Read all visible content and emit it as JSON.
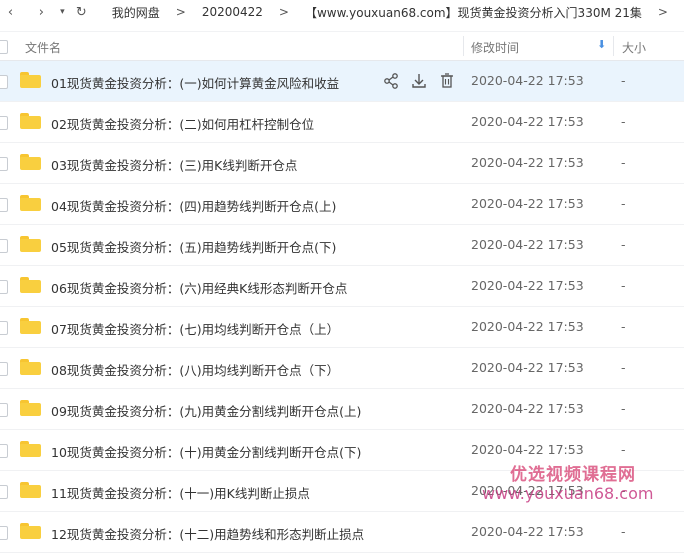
{
  "nav": {
    "back_icon": "chevron-left-icon",
    "forward_icon": "chevron-right-icon",
    "dropdown_icon": "caret-down-icon",
    "refresh_icon": "refresh-icon",
    "breadcrumbs": [
      "我的网盘",
      "20200422",
      "【www.youxuan68.com】现货黄金投资分析入门330M 21集"
    ],
    "separator": ">"
  },
  "columns": {
    "name": "文件名",
    "modified": "修改时间",
    "size": "大小",
    "sort_icon": "arrow-down-icon"
  },
  "files": [
    {
      "name": "01现货黄金投资分析：(一)如何计算黄金风险和收益",
      "modified": "2020-04-22 17:53",
      "size": "-"
    },
    {
      "name": "02现货黄金投资分析：(二)如何用杠杆控制仓位",
      "modified": "2020-04-22 17:53",
      "size": "-"
    },
    {
      "name": "03现货黄金投资分析：(三)用K线判断开仓点",
      "modified": "2020-04-22 17:53",
      "size": "-"
    },
    {
      "name": "04现货黄金投资分析：(四)用趋势线判断开仓点(上)",
      "modified": "2020-04-22 17:53",
      "size": "-"
    },
    {
      "name": "05现货黄金投资分析：(五)用趋势线判断开仓点(下)",
      "modified": "2020-04-22 17:53",
      "size": "-"
    },
    {
      "name": "06现货黄金投资分析：(六)用经典K线形态判断开仓点",
      "modified": "2020-04-22 17:53",
      "size": "-"
    },
    {
      "name": "07现货黄金投资分析：(七)用均线判断开仓点（上）",
      "modified": "2020-04-22 17:53",
      "size": "-"
    },
    {
      "name": "08现货黄金投资分析：(八)用均线判断开仓点（下）",
      "modified": "2020-04-22 17:53",
      "size": "-"
    },
    {
      "name": "09现货黄金投资分析：(九)用黄金分割线判断开仓点(上)",
      "modified": "2020-04-22 17:53",
      "size": "-"
    },
    {
      "name": "10现货黄金投资分析：(十)用黄金分割线判断开仓点(下)",
      "modified": "2020-04-22 17:53",
      "size": "-"
    },
    {
      "name": "11现货黄金投资分析：(十一)用K线判断止损点",
      "modified": "2020-04-22 17:53",
      "size": "-"
    },
    {
      "name": "12现货黄金投资分析：(十二)用趋势线和形态判断止损点",
      "modified": "2020-04-22 17:53",
      "size": "-"
    }
  ],
  "row_actions": [
    "share-icon",
    "download-icon",
    "delete-icon"
  ],
  "watermark": {
    "line1": "优选视频课程网",
    "line2": "www.youxuan68.com"
  },
  "colors": {
    "selected_row": "#eaf4fd",
    "folder": "#f9cf3f",
    "sort_accent": "#4a90e2"
  }
}
